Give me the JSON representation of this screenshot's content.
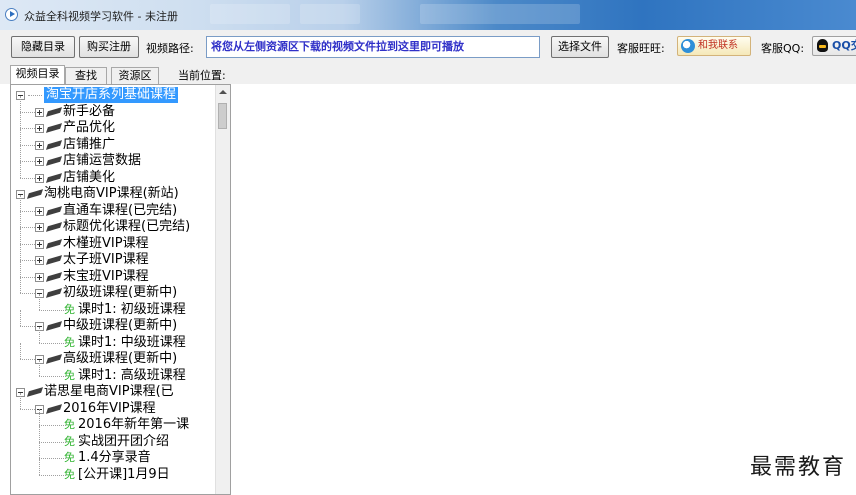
{
  "window": {
    "title": "众益全科视频学习软件 - 未注册"
  },
  "toolbar": {
    "hide_catalog": "隐藏目录",
    "buy_register": "购买注册",
    "video_path_label": "视频路径:",
    "video_path_value": "将您从左侧资源区下载的视频文件拉到这里即可播放",
    "choose_file": "选择文件",
    "service_wangwang_label": "客服旺旺:",
    "contact_me": "和我联系",
    "service_qq_label": "客服QQ:",
    "qq_button": "QQ交谈"
  },
  "tabs": {
    "catalog": "视频目录",
    "search": "查找",
    "resources": "资源区",
    "current_position_label": "当前位置:"
  },
  "tree": [
    {
      "label": "淘宝开店系列基础课程",
      "level": 0,
      "state": "expanded",
      "selected": true,
      "root_style": "dots"
    },
    {
      "label": "新手必备",
      "level": 1,
      "state": "collapsed",
      "icon": "book"
    },
    {
      "label": "产品优化",
      "level": 1,
      "state": "collapsed",
      "icon": "book"
    },
    {
      "label": "店铺推广",
      "level": 1,
      "state": "collapsed",
      "icon": "book"
    },
    {
      "label": "店铺运营数据",
      "level": 1,
      "state": "collapsed",
      "icon": "book"
    },
    {
      "label": "店铺美化",
      "level": 1,
      "state": "collapsed",
      "icon": "book"
    },
    {
      "label": "淘桃电商VIP课程(新站)",
      "level": 0,
      "state": "expanded",
      "icon": "book"
    },
    {
      "label": "直通车课程(已完结)",
      "level": 1,
      "state": "collapsed",
      "icon": "book"
    },
    {
      "label": "标题优化课程(已完结)",
      "level": 1,
      "state": "collapsed",
      "icon": "book"
    },
    {
      "label": "木槿班VIP课程",
      "level": 1,
      "state": "collapsed",
      "icon": "book"
    },
    {
      "label": "太子班VIP课程",
      "level": 1,
      "state": "collapsed",
      "icon": "book"
    },
    {
      "label": "末宝班VIP课程",
      "level": 1,
      "state": "collapsed",
      "icon": "book"
    },
    {
      "label": "初级班课程(更新中)",
      "level": 1,
      "state": "expanded",
      "icon": "book"
    },
    {
      "label": "课时1: 初级班课程",
      "level": 2,
      "state": "leaf",
      "icon": "free"
    },
    {
      "label": "中级班课程(更新中)",
      "level": 1,
      "state": "expanded",
      "icon": "book"
    },
    {
      "label": "课时1: 中级班课程",
      "level": 2,
      "state": "leaf",
      "icon": "free"
    },
    {
      "label": "高级班课程(更新中)",
      "level": 1,
      "state": "expanded",
      "icon": "book"
    },
    {
      "label": "课时1: 高级班课程",
      "level": 2,
      "state": "leaf",
      "icon": "free"
    },
    {
      "label": "诺思星电商VIP课程(已",
      "level": 0,
      "state": "expanded",
      "icon": "book"
    },
    {
      "label": "2016年VIP课程",
      "level": 1,
      "state": "expanded",
      "icon": "book"
    },
    {
      "label": "2016年新年第一课",
      "level": 2,
      "state": "leaf",
      "icon": "free"
    },
    {
      "label": "实战团开团介绍",
      "level": 2,
      "state": "leaf",
      "icon": "free"
    },
    {
      "label": "1.4分享录音",
      "level": 2,
      "state": "leaf",
      "icon": "free"
    },
    {
      "label": "[公开课]1月9日",
      "level": 2,
      "state": "leaf",
      "icon": "free"
    }
  ],
  "free_tag": "免",
  "watermark": "最需教育",
  "colors": {
    "selection": "#3399ff",
    "free_tag": "#32b432",
    "path_text": "#3030c8"
  }
}
